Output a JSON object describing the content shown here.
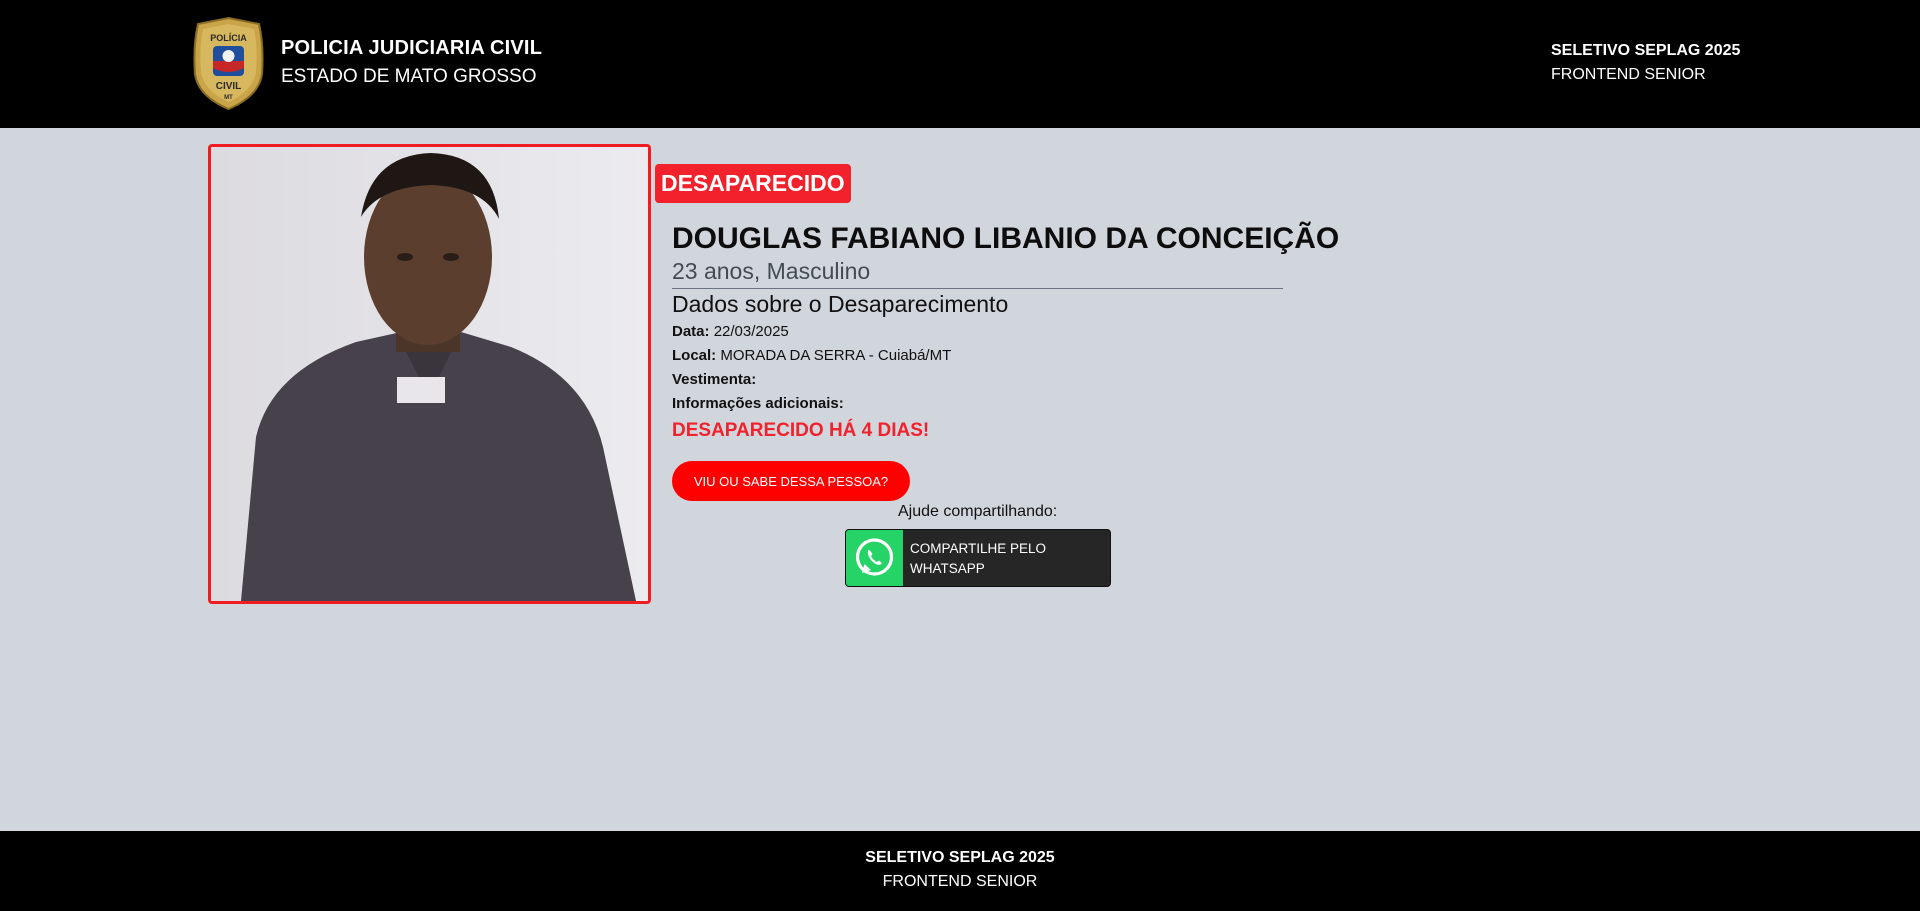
{
  "header": {
    "title": "POLICIA JUDICIARIA CIVIL",
    "subtitle": "ESTADO DE MATO GROSSO",
    "logo": {
      "top_text": "POLÍCIA",
      "bottom_text": "CIVIL",
      "small_text": "MT"
    },
    "right_line1": "SELETIVO SEPLAG 2025",
    "right_line2": "FRONTEND SENIOR"
  },
  "person": {
    "status": "DESAPARECIDO",
    "name": "DOUGLAS FABIANO LIBANIO DA CONCEIÇÃO",
    "info": "23 anos, Masculino",
    "section_title": "Dados sobre o Desaparecimento",
    "date_label": "Data:",
    "date_value": "22/03/2025",
    "location_label": "Local:",
    "location_value": "MORADA DA SERRA - Cuiabá/MT",
    "clothing_label": "Vestimenta:",
    "clothing_value": "",
    "extra_label": "Informações adicionais:",
    "extra_value": "",
    "days_missing": "DESAPARECIDO HÁ 4 DIAS!"
  },
  "actions": {
    "report_button": "VIU OU SABE DESSA PESSOA?",
    "share_label": "Ajude compartilhando:",
    "whatsapp_button": "COMPARTILHE PELO WHATSAPP"
  },
  "footer": {
    "line1": "SELETIVO SEPLAG 2025",
    "line2": "FRONTEND SENIOR"
  },
  "colors": {
    "accent": "#f1222c",
    "header_bg": "#000000",
    "page_bg": "#d1d5dc",
    "whatsapp": "#25d366"
  }
}
